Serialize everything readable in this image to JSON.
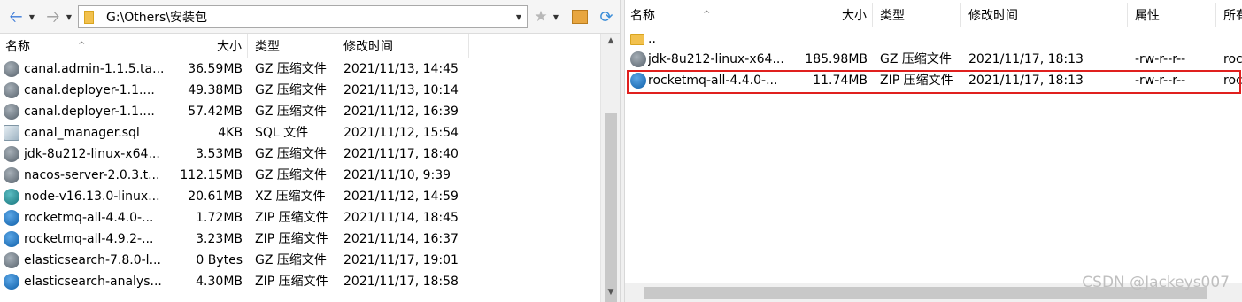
{
  "left": {
    "toolbar": {
      "back_icon": "back-arrow-icon",
      "forward_icon": "forward-arrow-icon",
      "address_value": "G:\\Others\\安装包",
      "bookmark_icon": "star-icon",
      "home_icon": "home-icon",
      "refresh_icon": "refresh-icon"
    },
    "columns": [
      "名称",
      "大小",
      "类型",
      "修改时间"
    ],
    "files": [
      {
        "name": "canal.admin-1.1.5.ta...",
        "size": "36.59MB",
        "type": "GZ 压缩文件",
        "modified": "2021/11/13, 14:45",
        "icon": "gz"
      },
      {
        "name": "canal.deployer-1.1....",
        "size": "49.38MB",
        "type": "GZ 压缩文件",
        "modified": "2021/11/13, 10:14",
        "icon": "gz"
      },
      {
        "name": "canal.deployer-1.1....",
        "size": "57.42MB",
        "type": "GZ 压缩文件",
        "modified": "2021/11/12, 16:39",
        "icon": "gz"
      },
      {
        "name": "canal_manager.sql",
        "size": "4KB",
        "type": "SQL 文件",
        "modified": "2021/11/12, 15:54",
        "icon": "sql"
      },
      {
        "name": "jdk-8u212-linux-x64...",
        "size": "3.53MB",
        "type": "GZ 压缩文件",
        "modified": "2021/11/17, 18:40",
        "icon": "gz"
      },
      {
        "name": "nacos-server-2.0.3.t...",
        "size": "112.15MB",
        "type": "GZ 压缩文件",
        "modified": "2021/11/10, 9:39",
        "icon": "gz"
      },
      {
        "name": "node-v16.13.0-linux...",
        "size": "20.61MB",
        "type": "XZ 压缩文件",
        "modified": "2021/11/12, 14:59",
        "icon": "xz"
      },
      {
        "name": "rocketmq-all-4.4.0-...",
        "size": "1.72MB",
        "type": "ZIP 压缩文件",
        "modified": "2021/11/14, 18:45",
        "icon": "zip"
      },
      {
        "name": "rocketmq-all-4.9.2-...",
        "size": "3.23MB",
        "type": "ZIP 压缩文件",
        "modified": "2021/11/14, 16:37",
        "icon": "zip"
      },
      {
        "name": "elasticsearch-7.8.0-l...",
        "size": "0 Bytes",
        "type": "GZ 压缩文件",
        "modified": "2021/11/17, 19:01",
        "icon": "gz"
      },
      {
        "name": "elasticsearch-analys...",
        "size": "4.30MB",
        "type": "ZIP 压缩文件",
        "modified": "2021/11/17, 18:58",
        "icon": "zip"
      }
    ]
  },
  "right": {
    "columns": [
      "名称",
      "大小",
      "类型",
      "修改时间",
      "属性",
      "所有"
    ],
    "parent_label": "..",
    "files": [
      {
        "name": "jdk-8u212-linux-x64...",
        "size": "185.98MB",
        "type": "GZ 压缩文件",
        "modified": "2021/11/17, 18:13",
        "attrs": "-rw-r--r--",
        "owner": "roc",
        "icon": "gz"
      },
      {
        "name": "rocketmq-all-4.4.0-...",
        "size": "11.74MB",
        "type": "ZIP 压缩文件",
        "modified": "2021/11/17, 18:13",
        "attrs": "-rw-r--r--",
        "owner": "roc",
        "icon": "zip"
      }
    ]
  },
  "watermark": "CSDN @Jackeys007",
  "colors": {
    "highlight": "#e0201e"
  }
}
